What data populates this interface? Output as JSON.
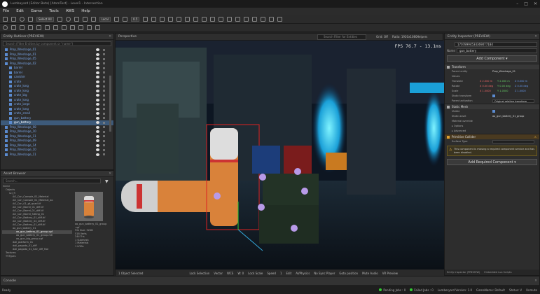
{
  "window": {
    "title": "Lumbayard (Editor Beta) [AtomTest] - Level1 - Intersection"
  },
  "menu": [
    "File",
    "Edit",
    "Game",
    "Tools",
    "AWS",
    "Help"
  ],
  "toolbar": {
    "select_mode": "Select All",
    "layer": "Local",
    "snap": "0.5"
  },
  "outliner": {
    "title": "Entity Outliner (PREVIEW)",
    "search_placeholder": "Search (Filter Entities by component or \"name\")",
    "rows": [
      {
        "label": "Prop_Wreckage_01",
        "indent": 1,
        "blue": true
      },
      {
        "label": "Prop_Wreckage_01",
        "indent": 1,
        "blue": true
      },
      {
        "label": "Prop_Wreckage_05",
        "indent": 1,
        "blue": true
      },
      {
        "label": "Prop_Wreckage_02",
        "indent": 1,
        "blue": true
      },
      {
        "label": "barrel",
        "indent": 2,
        "blue": true
      },
      {
        "label": "barrel",
        "indent": 2,
        "blue": true
      },
      {
        "label": "canister",
        "indent": 2,
        "blue": true
      },
      {
        "label": "crate",
        "indent": 2,
        "blue": true
      },
      {
        "label": "crate_long",
        "indent": 2,
        "blue": true
      },
      {
        "label": "crate_long",
        "indent": 2,
        "blue": true
      },
      {
        "label": "crate_big",
        "indent": 2,
        "blue": true
      },
      {
        "label": "crate_long",
        "indent": 2,
        "blue": true
      },
      {
        "label": "crate_large",
        "indent": 2,
        "blue": true
      },
      {
        "label": "crate_long",
        "indent": 2,
        "blue": true
      },
      {
        "label": "crate_small",
        "indent": 2,
        "blue": true
      },
      {
        "label": "gun_battery",
        "indent": 2,
        "blue": true
      },
      {
        "label": "gun_battery",
        "indent": 2,
        "blue": false,
        "selected": true
      },
      {
        "label": "Prop_Wreckage_08",
        "indent": 1,
        "blue": true
      },
      {
        "label": "Prop_Wreckage_10",
        "indent": 1,
        "blue": true
      },
      {
        "label": "Prop_Wreckage_11",
        "indent": 1,
        "blue": true
      },
      {
        "label": "Prop_Wreckage_09",
        "indent": 1,
        "blue": true
      },
      {
        "label": "Prop_Wreckage_14",
        "indent": 1,
        "blue": true
      },
      {
        "label": "Prop_Wreckage_10",
        "indent": 1,
        "blue": true
      },
      {
        "label": "Prop_Wreckage_11",
        "indent": 1,
        "blue": true
      }
    ]
  },
  "asset_browser": {
    "title": "Asset Browser",
    "search_placeholder": "Search...",
    "column_header": "Name",
    "rows": [
      {
        "label": "Objects",
        "indent": 1
      },
      {
        "label": "sci_fi",
        "indent": 2
      },
      {
        "label": "AO_Con_Console_01_Material",
        "indent": 3
      },
      {
        "label": "AO_Con_Console_01_Material_ao",
        "indent": 3
      },
      {
        "label": "AO_Con_01_gf_quad.tif",
        "indent": 3
      },
      {
        "label": "AO_Con_Barrel_01_diff.tif",
        "indent": 3
      },
      {
        "label": "AO_Con_Barrel_01_diff.tif",
        "indent": 3
      },
      {
        "label": "AO_Con_Barrel_Sitting_01",
        "indent": 3
      },
      {
        "label": "AO_Con_Battery_01_diff.tif",
        "indent": 3
      },
      {
        "label": "AO_Con_Battery_02_diff.tif",
        "indent": 3
      },
      {
        "label": "AO_Con_Battery_01_diff.tif",
        "indent": 3
      },
      {
        "label": "ao_gun_battery_01",
        "indent": 3
      },
      {
        "label": "ao_gun_battery_01_group.cgf",
        "indent": 4,
        "selected": true
      },
      {
        "label": "ao_gun_battery_01_group.mtl",
        "indent": 4
      },
      {
        "label": "ao_gun_big_group.cgf",
        "indent": 4
      },
      {
        "label": "doll_platform_01",
        "indent": 3
      },
      {
        "label": "doll_pagoda_01_diff",
        "indent": 3
      },
      {
        "label": "doll_pagoda_01_hair_diff_fixe",
        "indent": 3
      },
      {
        "label": "Textures",
        "indent": 1
      },
      {
        "label": "TVTypes",
        "indent": 1
      }
    ],
    "thumb_caption": "ao_gun_battery_01_group.cgf",
    "thumb_info": [
      "ao_gun_battery_01_group",
      ".cgf",
      "File Size: 52KB",
      "518 Verts",
      "244 Tris",
      "1 Submesh",
      "1 Materials",
      "1 LODs"
    ]
  },
  "viewport": {
    "title": "Perspective",
    "search_placeholder": "Search Filter for Entities",
    "buttons": [
      "Grid: Off",
      "Ratio: 1920x1080",
      "Helpers"
    ],
    "fps": "FPS 76.7 - 13.1ms",
    "footer": [
      "1 Object Selected",
      "Lock Selection",
      "Vector",
      "WCS",
      "W: 0",
      "Lock Scale",
      "Speed",
      "1",
      "Edit",
      "AI/Physics",
      "No Sync Player",
      "Goto position",
      "Mute Audio",
      "VR Preview"
    ]
  },
  "inspector": {
    "title": "Entity Inspector (PREVIEW)",
    "entity_id": "17078994534369077184",
    "name_label": "Name",
    "name_value": "gun_battery",
    "add_component": "Add Component",
    "transform": {
      "title": "Transform",
      "parent_label": "Parent entity",
      "parent_value": "Prop_Wreckage_01",
      "values_label": "Values",
      "translate_label": "Translate",
      "translate": [
        "X 2.000 m",
        "Y 2.000 m",
        "Z 0.000 m"
      ],
      "rotate_label": "Rotate",
      "rotate": [
        "X 0.00 deg",
        "Y 0.00 deg",
        "Z 0.00 deg"
      ],
      "scale_label": "Scale",
      "scale": [
        "X 1.0000",
        "Y 1.0000",
        "Z 1.0000"
      ],
      "static_label": "Static transform",
      "parent_act_label": "Parent activation",
      "parent_act_value": "Original relative transform"
    },
    "mesh": {
      "title": "Static Mesh",
      "visible_label": "Visible",
      "mesh_label": "Static asset",
      "mesh_value": "ao_gun_battery_01_group",
      "mat_label": "Material override",
      "options_label": "Options",
      "advanced_label": "Advanced"
    },
    "collider": {
      "title": "Primitive Collider",
      "shape_label": "Surface Type",
      "warning": "This component is missing a required component service and has been disabled."
    },
    "add_required": "Add Required Component",
    "tabs": [
      "Entity Inspector (PREVIEW)",
      "Embedded Lua Scripts"
    ]
  },
  "console": {
    "title": "Console"
  },
  "status": {
    "left": "Ready",
    "right": [
      "Pending Jobs : 0",
      "Failed Jobs : 0",
      "Lumberyard Version: 1.0",
      "GameName: Default",
      "Status: V",
      "Unmute"
    ]
  }
}
